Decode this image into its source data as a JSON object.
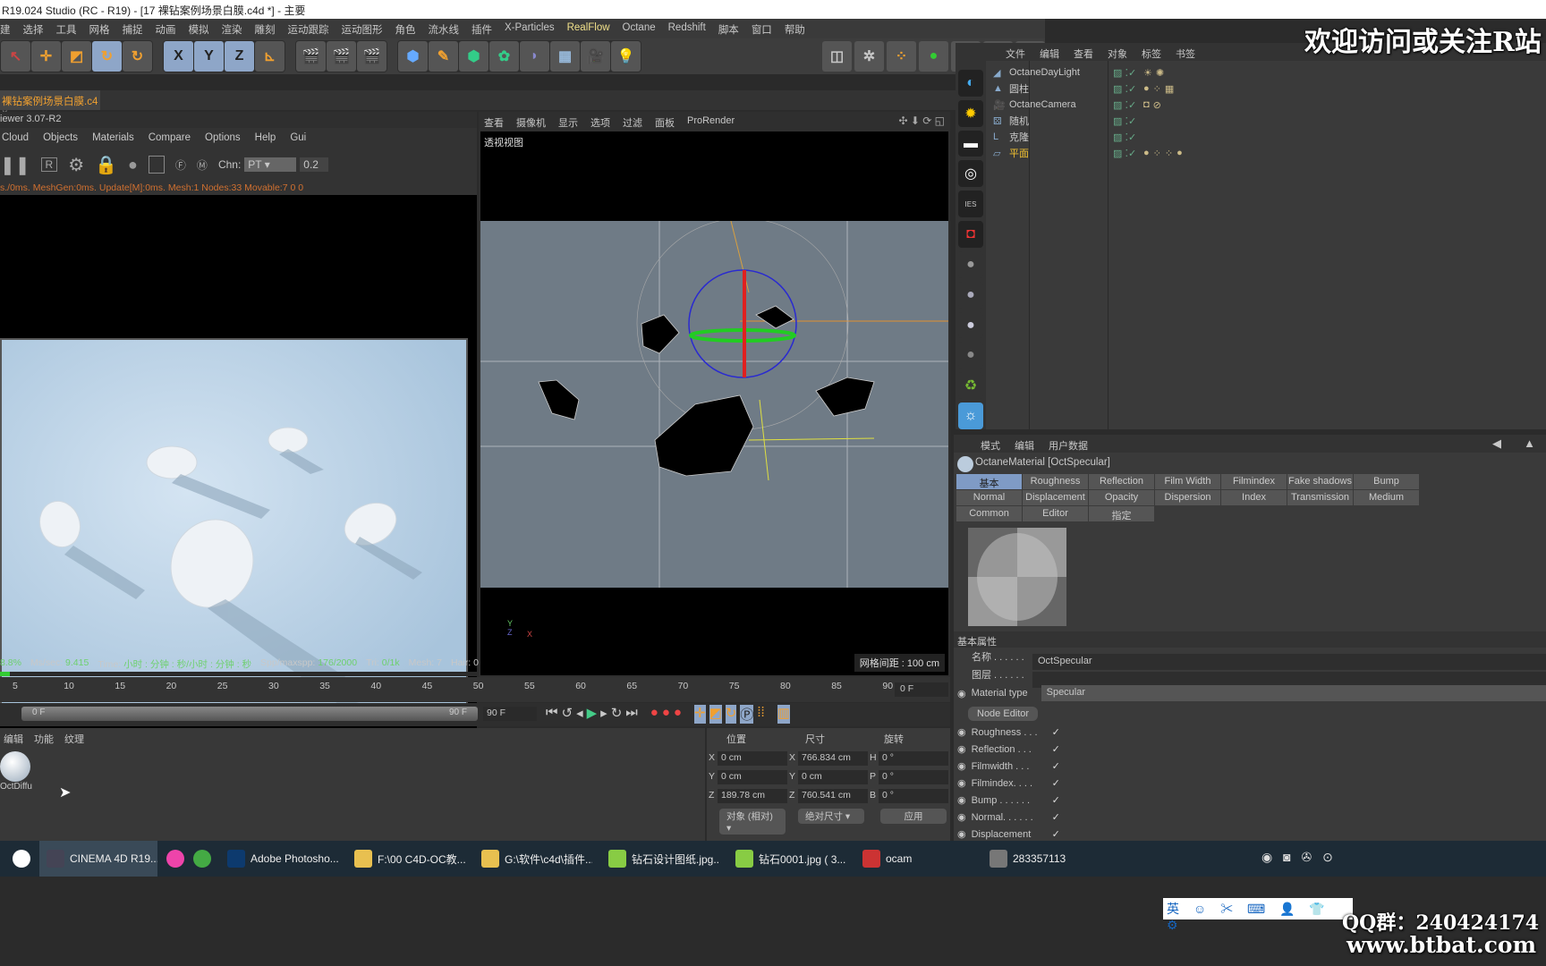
{
  "window": {
    "title": "R19.024 Studio (RC - R19) - [17 裸钻案例场景白膜.c4d *] - 主要"
  },
  "menu": [
    "建",
    "选择",
    "工具",
    "网格",
    "捕捉",
    "动画",
    "模拟",
    "渲染",
    "雕刻",
    "运动跟踪",
    "运动图形",
    "角色",
    "流水线",
    "插件",
    "X-Particles",
    "RealFlow",
    "Octane",
    "Redshift",
    "脚本",
    "窗口",
    "帮助"
  ],
  "toolbar": {
    "axis": [
      "X",
      "Y",
      "Z"
    ]
  },
  "doc_tab": "裸钻案例场景白膜.c4",
  "live_viewer": {
    "title": "iewer 3.07-R2",
    "menu": [
      "Cloud",
      "Objects",
      "Materials",
      "Compare",
      "Options",
      "Help",
      "Gui"
    ],
    "chn_label": "Chn:",
    "chn_value": "PT",
    "chn_num": "0.2",
    "status": "s./0ms. MeshGen:0ms. Update[M]:0ms. Mesh:1 Nodes:33 Movable:7  0 0",
    "stats": {
      "pct": "8.8%",
      "ms_label": "Ms/sec:",
      "ms": "9.415",
      "time_label": "Time:",
      "time": "小时 : 分钟 : 秒/小时 : 分钟 : 秒",
      "spp_label": "Spp/maxspp:",
      "spp": "176/2000",
      "tri_label": "Tri:",
      "tri": "0/1k",
      "mesh": "Mesh: 7",
      "hair": "Hair: 0",
      "gp": "GP"
    },
    "progress": 0.02
  },
  "viewport": {
    "menu": [
      "查看",
      "摄像机",
      "显示",
      "选项",
      "过滤",
      "面板",
      "ProRender"
    ],
    "label": "透视视图",
    "grid": "网格间距 : 100 cm",
    "axis": [
      "Y",
      "Z",
      "X"
    ]
  },
  "object_manager": {
    "menu": [
      "文件",
      "编辑",
      "查看",
      "对象",
      "标签",
      "书签"
    ],
    "objects": [
      {
        "name": "OctaneDayLight"
      },
      {
        "name": "圆柱"
      },
      {
        "name": "OctaneCamera"
      },
      {
        "name": "随机"
      },
      {
        "name": "克隆"
      },
      {
        "name": "平面"
      }
    ]
  },
  "attribute_manager": {
    "menu": [
      "模式",
      "编辑",
      "用户数据"
    ],
    "title": "OctaneMaterial [OctSpecular]",
    "tabs": [
      "基本",
      "Roughness",
      "Reflection",
      "Film Width",
      "Filmindex",
      "Fake shadows",
      "Bump",
      "Normal",
      "Displacement",
      "Opacity",
      "Dispersion",
      "Index",
      "Transmission",
      "Medium",
      "Common",
      "Editor",
      "指定"
    ],
    "section": "基本属性",
    "name_label": "名称 . . . . . . .",
    "name_value": "OctSpecular",
    "layer_label": "图层 . . . . . . .",
    "mattype_label": "Material type",
    "mattype_value": "Specular",
    "node_editor": "Node Editor",
    "checks": [
      "Roughness . . .",
      "Reflection . . .",
      "Filmwidth . . .",
      "Filmindex. . . .",
      "Bump . . . . . .",
      "Normal. . . . . .",
      "Displacement"
    ]
  },
  "timeline": {
    "ticks": [
      "5",
      "10",
      "15",
      "20",
      "25",
      "30",
      "35",
      "40",
      "45",
      "50",
      "55",
      "60",
      "65",
      "70",
      "75",
      "80",
      "85",
      "90"
    ],
    "current": "0 F",
    "range_start": "0 F",
    "range_end": "90 F",
    "end": "90 F"
  },
  "material_panel": {
    "menu": [
      "编辑",
      "功能",
      "纹理"
    ],
    "material": "OctDiffu"
  },
  "coords": {
    "headers": [
      "位置",
      "尺寸",
      "旋转"
    ],
    "rows": [
      {
        "a": "X",
        "pos": "0 cm",
        "s": "X",
        "size": "766.834 cm",
        "r": "H",
        "rot": "0 °"
      },
      {
        "a": "Y",
        "pos": "0 cm",
        "s": "Y",
        "size": "0 cm",
        "r": "P",
        "rot": "0 °"
      },
      {
        "a": "Z",
        "pos": "189.78 cm",
        "s": "Z",
        "size": "760.541 cm",
        "r": "B",
        "rot": "0 °"
      }
    ],
    "mode": "对象 (相对)",
    "size_mode": "绝对尺寸",
    "apply": "应用"
  },
  "taskbar": [
    "CINEMA 4D R19....",
    "Adobe Photosho...",
    "F:\\00 C4D-OC教...",
    "G:\\软件\\c4d\\插件...",
    "钻石设计图纸.jpg...",
    "钻石0001.jpg ( 3...",
    "ocam",
    "283357113"
  ],
  "ime": "英",
  "watermark": {
    "top": "欢迎访问或关注R站",
    "qq": "QQ群：240424174",
    "site": "www.btbat.com"
  }
}
